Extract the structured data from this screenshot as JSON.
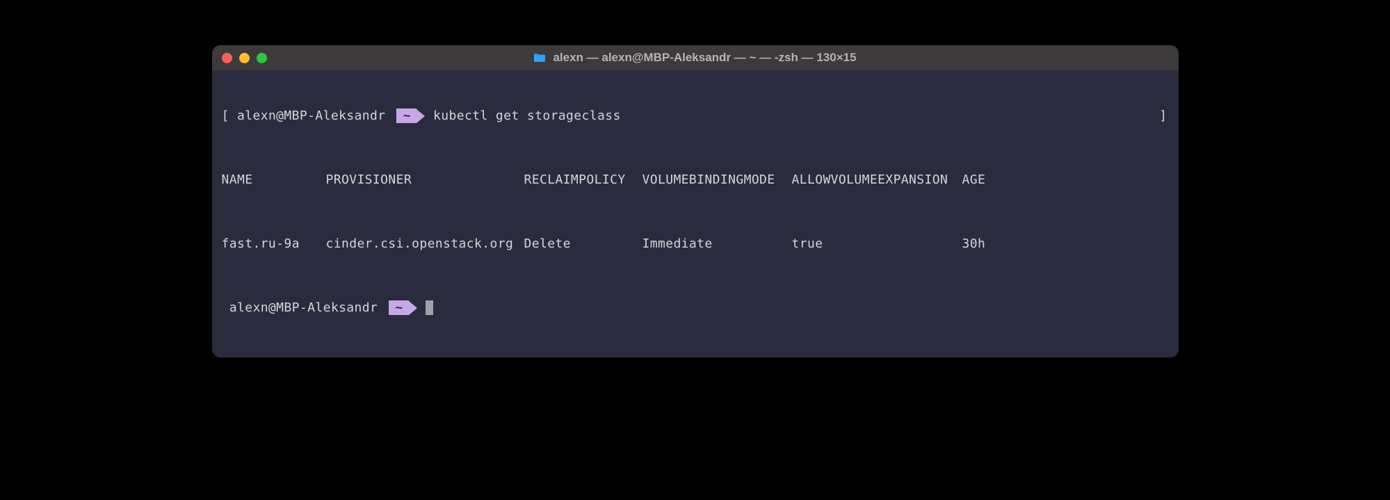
{
  "window": {
    "title": "alexn — alexn@MBP-Aleksandr — ~ — -zsh — 130×15"
  },
  "prompt": {
    "open_bracket": "[",
    "close_bracket": "]",
    "user_host": "alexn@MBP-Aleksandr",
    "cwd_chip": "~",
    "command": "kubectl get storageclass"
  },
  "table": {
    "headers": {
      "name": "NAME",
      "provisioner": "PROVISIONER",
      "reclaim": "RECLAIMPOLICY",
      "binding": "VOLUMEBINDINGMODE",
      "expansion": "ALLOWVOLUMEEXPANSION",
      "age": "AGE"
    },
    "rows": [
      {
        "name": "fast.ru-9a",
        "provisioner": "cinder.csi.openstack.org",
        "reclaim": "Delete",
        "binding": "Immediate",
        "expansion": "true",
        "age": "30h"
      }
    ]
  },
  "prompt2": {
    "user_host": "alexn@MBP-Aleksandr",
    "cwd_chip": "~"
  }
}
